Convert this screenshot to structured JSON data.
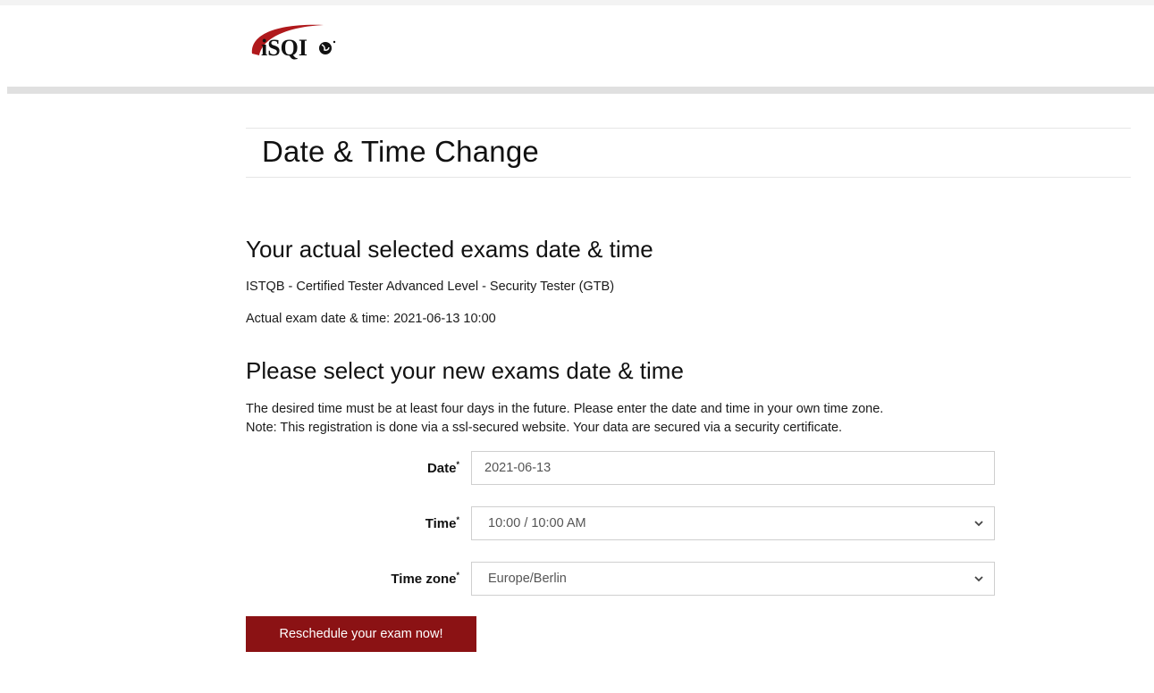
{
  "header": {
    "logo_text": "iSQI",
    "brand_color": "#8b1214"
  },
  "page": {
    "title": "Date & Time Change"
  },
  "current": {
    "heading": "Your actual selected exams date & time",
    "exam_name": "ISTQB - Certified Tester Advanced Level - Security Tester (GTB)",
    "actual_datetime": "Actual exam date & time: 2021-06-13 10:00"
  },
  "new_selection": {
    "heading": "Please select your new exams date & time",
    "note_line1": "The desired time must be at least four days in the future. Please enter the date and time in your own time zone.",
    "note_line2": "Note: This registration is done via a ssl-secured website. Your data are secured via a security certificate."
  },
  "form": {
    "date_label": "Date",
    "date_value": "2021-06-13",
    "time_label": "Time",
    "time_value": "10:00 / 10:00 AM",
    "timezone_label": "Time zone",
    "timezone_value": "Europe/Berlin",
    "required_marker": "*",
    "submit_label": "Reschedule your exam now!"
  }
}
